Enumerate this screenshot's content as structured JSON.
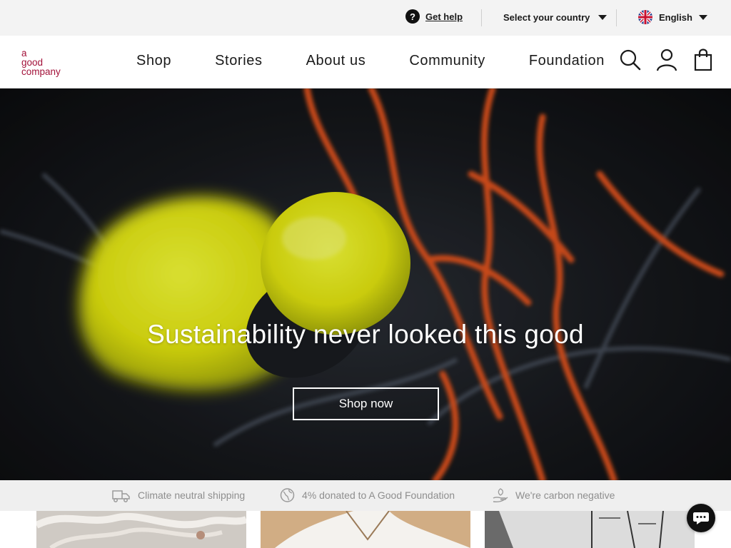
{
  "utility_bar": {
    "help_label": "Get help",
    "help_icon": "question-circle-icon",
    "country_label": "Select your country",
    "language_label": "English",
    "language_icon": "uk-flag-icon"
  },
  "nav": {
    "logo_lines": [
      "a",
      "good",
      "company"
    ],
    "logo_color": "#a3123a",
    "items": [
      {
        "label": "Shop"
      },
      {
        "label": "Stories"
      },
      {
        "label": "About us"
      },
      {
        "label": "Community"
      },
      {
        "label": "Foundation"
      }
    ],
    "icons": [
      "search-icon",
      "account-icon",
      "bag-icon"
    ]
  },
  "hero": {
    "title": "Sustainability never looked this good",
    "cta_label": "Shop now"
  },
  "usp": [
    {
      "icon": "truck-icon",
      "label": "Climate neutral shipping"
    },
    {
      "icon": "globe-icon",
      "label": "4% donated to A Good Foundation"
    },
    {
      "icon": "hand-leaf-icon",
      "label": "We're carbon negative"
    }
  ],
  "colors": {
    "accent": "#a3123a",
    "usp_text": "#8e8e8e",
    "utility_bg": "#f3f3f3"
  }
}
